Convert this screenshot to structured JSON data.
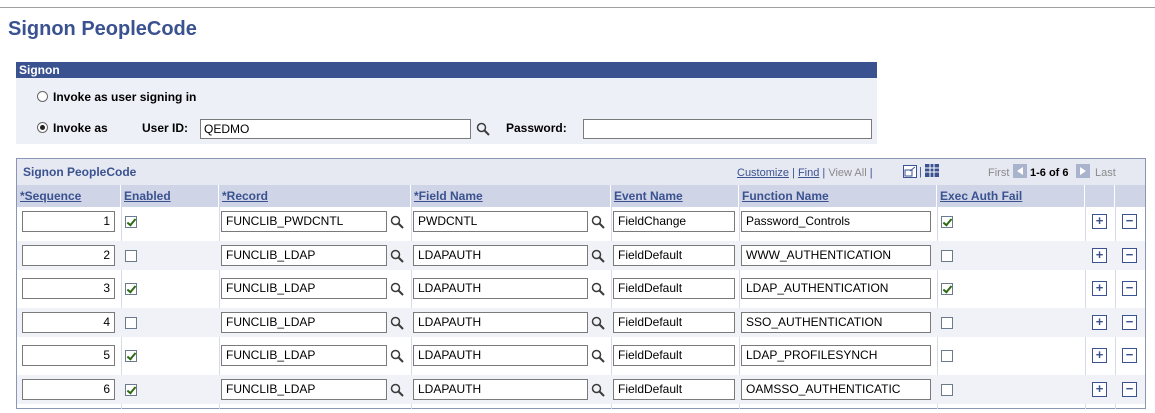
{
  "page": {
    "title": "Signon PeopleCode"
  },
  "signon": {
    "header": "Signon",
    "option1_label": "Invoke as user signing in",
    "option2_label": "Invoke as",
    "userid_label": "User ID:",
    "userid_value": "QEDMO",
    "password_label": "Password:",
    "password_value": ""
  },
  "grid": {
    "title": "Signon PeopleCode",
    "nav": {
      "customize": "Customize",
      "find": "Find",
      "view_all": "View All",
      "first": "First",
      "range": "1-6 of 6",
      "last": "Last"
    },
    "columns": [
      "*Sequence",
      "Enabled",
      "*Record",
      "*Field Name",
      "Event Name",
      "Function Name",
      "Exec Auth Fail"
    ],
    "rows": [
      {
        "sequence": "1",
        "enabled": true,
        "record": "FUNCLIB_PWDCNTL",
        "field": "PWDCNTL",
        "event": "FieldChange",
        "function": "Password_Controls",
        "exec_auth_fail": true
      },
      {
        "sequence": "2",
        "enabled": false,
        "record": "FUNCLIB_LDAP",
        "field": "LDAPAUTH",
        "event": "FieldDefault",
        "function": "WWW_AUTHENTICATION",
        "exec_auth_fail": false
      },
      {
        "sequence": "3",
        "enabled": true,
        "record": "FUNCLIB_LDAP",
        "field": "LDAPAUTH",
        "event": "FieldDefault",
        "function": "LDAP_AUTHENTICATION",
        "exec_auth_fail": true
      },
      {
        "sequence": "4",
        "enabled": false,
        "record": "FUNCLIB_LDAP",
        "field": "LDAPAUTH",
        "event": "FieldDefault",
        "function": "SSO_AUTHENTICATION",
        "exec_auth_fail": false
      },
      {
        "sequence": "5",
        "enabled": true,
        "record": "FUNCLIB_LDAP",
        "field": "LDAPAUTH",
        "event": "FieldDefault",
        "function": "LDAP_PROFILESYNCH",
        "exec_auth_fail": false
      },
      {
        "sequence": "6",
        "enabled": true,
        "record": "FUNCLIB_LDAP",
        "field": "LDAPAUTH",
        "event": "FieldDefault",
        "function": "OAMSSO_AUTHENTICATIC",
        "exec_auth_fail": false
      }
    ],
    "add_symbol": "+",
    "delete_symbol": "−"
  },
  "colors": {
    "header_blue": "#3b5290",
    "section_bg": "#eef0f7",
    "col_head_bg": "#cfd5e6"
  },
  "icons": {
    "lookup": "magnifier-icon",
    "add": "plus-icon",
    "delete": "minus-icon",
    "download": "spreadsheet-icon",
    "zoom": "zoom-icon"
  }
}
